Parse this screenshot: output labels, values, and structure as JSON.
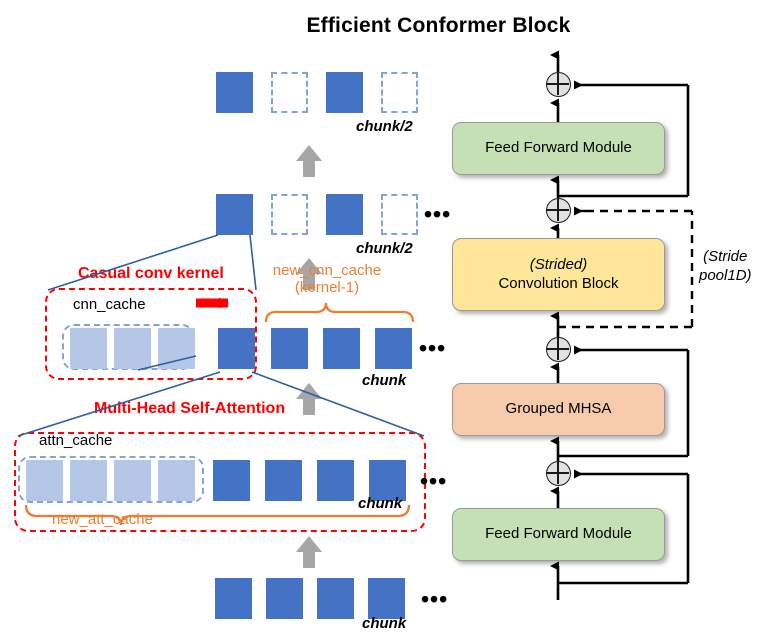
{
  "title": "Efficient Conformer Block",
  "left_diagram": {
    "rows": [
      {
        "id": "row-output-top",
        "label": "chunk/2",
        "ellipsis": "",
        "squares": [
          "solid",
          "ghost",
          "solid",
          "ghost"
        ]
      },
      {
        "id": "row-after-conv",
        "label": "chunk/2",
        "ellipsis": "•••",
        "squares": [
          "solid",
          "ghost",
          "solid",
          "ghost"
        ]
      },
      {
        "id": "row-conv",
        "label": "chunk",
        "ellipsis": "•••",
        "squares": [
          "light",
          "light",
          "light",
          "solid",
          "solid",
          "solid",
          "solid"
        ]
      },
      {
        "id": "row-attention",
        "label": "chunk",
        "ellipsis": "•••",
        "squares": [
          "light",
          "light",
          "light",
          "light",
          "solid",
          "solid",
          "solid",
          "solid"
        ]
      },
      {
        "id": "row-input",
        "label": "chunk",
        "ellipsis": "•••",
        "squares": [
          "solid",
          "solid",
          "solid",
          "solid"
        ]
      }
    ],
    "annotations": {
      "casual_conv_kernel": "Casual conv kernel",
      "cnn_cache": "cnn_cache",
      "new_cnn_cache_line1": "new_cnn_cache",
      "new_cnn_cache_line2": "(kernel-1)",
      "multi_head_self_attention": "Multi-Head Self-Attention",
      "attn_cache": "attn_cache",
      "new_att_cache": "new_att_cache"
    }
  },
  "block_diagram": {
    "modules": [
      {
        "id": "feed-forward-top",
        "label": "Feed Forward Module",
        "color": "#C5E0B4"
      },
      {
        "id": "convolution-block",
        "label_italic": "(Strided)",
        "label": "Convolution Block",
        "color": "#FFE699"
      },
      {
        "id": "grouped-mhsa",
        "label": "Grouped MHSA",
        "color": "#F8CBAD"
      },
      {
        "id": "feed-forward-bottom",
        "label": "Feed Forward Module",
        "color": "#C5E0B4"
      }
    ],
    "stride_note_line1": "(Stride",
    "stride_note_line2": "pool1D)",
    "adder_symbol": "⊕"
  },
  "colors": {
    "blue_solid": "#4472C4",
    "blue_light": "#B4C7E7",
    "red_dashed": "#FF0000",
    "orange": "#ED7D31",
    "gray_arrow": "#A6A6A6",
    "green": "#C5E0B4",
    "yellow": "#FFE699",
    "peach": "#F8CBAD"
  }
}
